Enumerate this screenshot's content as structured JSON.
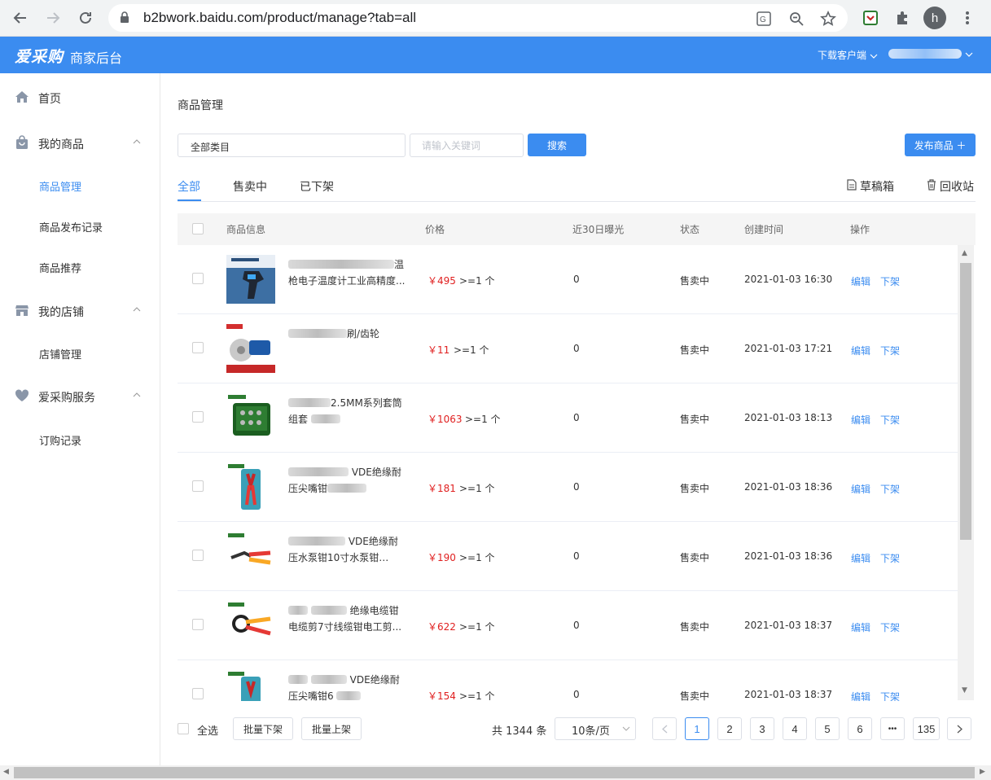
{
  "browser": {
    "url": "b2bwork.baidu.com/product/manage?tab=all",
    "profile_initial": "h"
  },
  "header": {
    "logo": "爱采购",
    "subtitle": "商家后台",
    "download_label": "下载客户端"
  },
  "sidebar": {
    "groups": [
      {
        "label": "首页",
        "icon": "home-icon"
      },
      {
        "label": "我的商品",
        "icon": "bag-icon",
        "items": [
          "商品管理",
          "商品发布记录",
          "商品推荐"
        ]
      },
      {
        "label": "我的店铺",
        "icon": "store-icon",
        "items": [
          "店铺管理"
        ]
      },
      {
        "label": "爱采购服务",
        "icon": "heart-icon",
        "items": [
          "订购记录"
        ]
      }
    ],
    "active_item": "商品管理"
  },
  "main": {
    "title": "商品管理",
    "category_select": "全部类目",
    "keyword_placeholder": "请输入关键词",
    "search_label": "搜索",
    "publish_label": "发布商品 ＋",
    "tabs": [
      "全部",
      "售卖中",
      "已下架"
    ],
    "drafts_label": "草稿箱",
    "recycle_label": "回收站",
    "columns": [
      "商品信息",
      "价格",
      "近30日曝光",
      "状态",
      "创建时间",
      "操作"
    ],
    "edit_label": "编辑",
    "offline_label": "下架",
    "rows": [
      {
        "name_l1": "温",
        "name_l2": "枪电子温度计工业高精度...",
        "price": "￥495",
        "qty": ">=1 个",
        "exposure": "0",
        "status": "售卖中",
        "created": "2021-01-03 16:30"
      },
      {
        "name_l1": "刷/齿轮",
        "name_l2": "",
        "price": "￥11",
        "qty": ">=1 个",
        "exposure": "0",
        "status": "售卖中",
        "created": "2021-01-03 17:21"
      },
      {
        "name_l1": "2.5MM系列套筒",
        "name_l2": "组套",
        "price": "￥1063",
        "qty": ">=1 个",
        "exposure": "0",
        "status": "售卖中",
        "created": "2021-01-03 18:13"
      },
      {
        "name_l1": "VDE绝缘耐",
        "name_l2": "压尖嘴钳",
        "price": "￥181",
        "qty": ">=1 个",
        "exposure": "0",
        "status": "售卖中",
        "created": "2021-01-03 18:36"
      },
      {
        "name_l1": "VDE绝缘耐",
        "name_l2": "压水泵钳10寸水泵钳",
        "price": "￥190",
        "qty": ">=1 个",
        "exposure": "0",
        "status": "售卖中",
        "created": "2021-01-03 18:36"
      },
      {
        "name_l1": "绝缘电缆钳",
        "name_l2": "电缆剪7寸线缆钳电工剪...",
        "price": "￥622",
        "qty": ">=1 个",
        "exposure": "0",
        "status": "售卖中",
        "created": "2021-01-03 18:37"
      },
      {
        "name_l1": "VDE绝缘耐",
        "name_l2": "压尖嘴钳6",
        "price": "￥154",
        "qty": ">=1 个",
        "exposure": "0",
        "status": "售卖中",
        "created": "2021-01-03 18:37"
      }
    ]
  },
  "footer": {
    "select_all": "全选",
    "batch_offline": "批量下架",
    "batch_online": "批量上架",
    "total": "共 1344 条",
    "page_size": "10条/页",
    "pages": [
      "1",
      "2",
      "3",
      "4",
      "5",
      "6",
      "•••",
      "135"
    ],
    "current_page": "1"
  },
  "colors": {
    "brand": "#3b8cf0",
    "price": "#e02020"
  }
}
